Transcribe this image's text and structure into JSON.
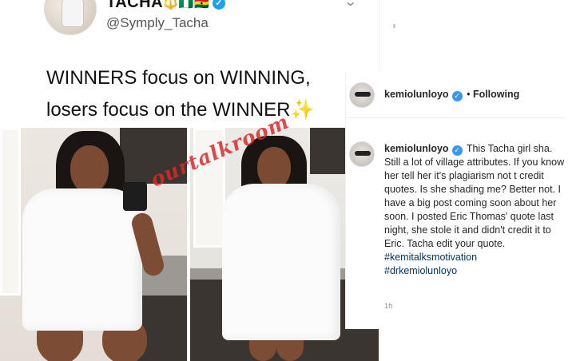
{
  "tweet": {
    "name": "TACHA",
    "flags": "🔱🇳🇬🇬🇭",
    "verified_icon": "✓",
    "handle": "@Symply_Tacha",
    "menu_icon": "⌄",
    "text_line1": "WINNERS focus on WINNING,",
    "text_line2": "losers focus on the WINNER",
    "sparkle": "✨",
    "watermark": "ourtalkroom"
  },
  "instagram": {
    "header": {
      "username": "kemiolunloyo",
      "verified_icon": "✓",
      "separator": "•",
      "follow_status": "Following"
    },
    "caption": {
      "username": "kemiolunloyo",
      "verified_icon": "✓",
      "text": "This Tacha girl sha. Still a lot of village attributes. If you know her tell her it's plagiarism not t credit quotes. Is she shading me? Better not. I have a big post coming soon about her soon. I posted Eric Thomas' quote last night, she stole it and didn't credit it to Eric. Tacha edit your quote.",
      "hashtags": [
        "#kemitalksmotivation",
        "#drkemiolunloyo"
      ],
      "time": "1h"
    }
  },
  "colors": {
    "twitter_blue": "#1da1f2",
    "instagram_blue": "#3897f0",
    "hashtag": "#003569",
    "watermark": "#dc2828"
  }
}
